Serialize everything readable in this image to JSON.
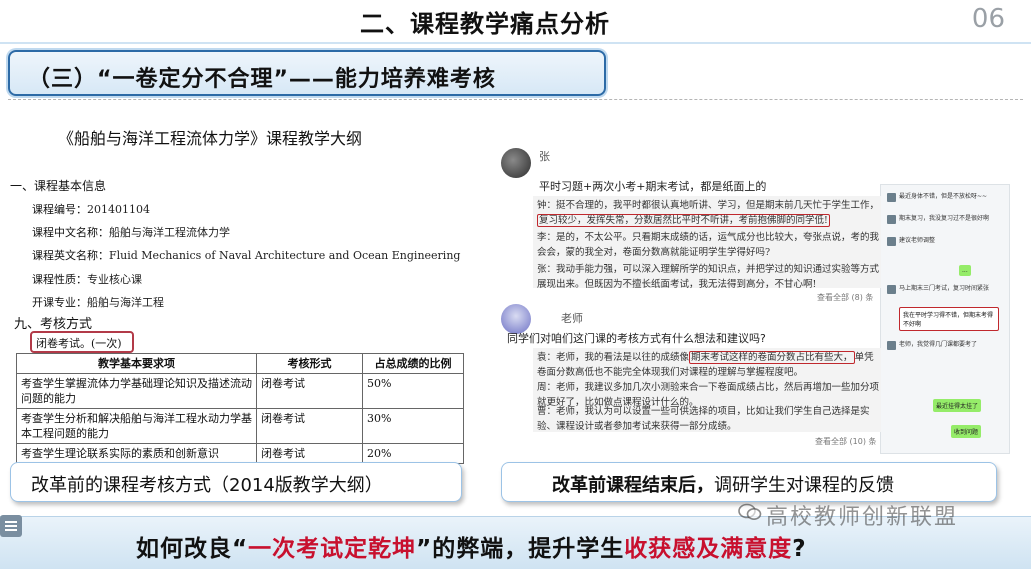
{
  "header": {
    "title": "二、课程教学痛点分析",
    "page_number": "06"
  },
  "banner": {
    "text": "（三）“一卷定分不合理”——能力培养难考核"
  },
  "syllabus": {
    "title": "《船舶与海洋工程流体力学》课程教学大纲",
    "section1": "一、课程基本信息",
    "fields": [
      {
        "label": "课程编号：",
        "value": "201401104"
      },
      {
        "label": "课程中文名称：",
        "value": "船舶与海洋工程流体力学"
      },
      {
        "label": "课程英文名称：",
        "value": "Fluid Mechanics of Naval Architecture and Ocean Engineering"
      },
      {
        "label": "课程性质：",
        "value": "专业核心课"
      },
      {
        "label": "开课专业：",
        "value": "船舶与海洋工程"
      }
    ],
    "section9": "九、考核方式",
    "closed_exam": "闭卷考试。(一次)",
    "table": {
      "headers": [
        "教学基本要求项",
        "考核形式",
        "占总成绩的比例"
      ],
      "rows": [
        [
          "考查学生掌握流体力学基础理论知识及描述流动问题的能力",
          "闭卷考试",
          "50%"
        ],
        [
          "考查学生分析和解决船舶与海洋工程水动力学基本工程问题的能力",
          "闭卷考试",
          "30%"
        ],
        [
          "考查学生理论联系实际的素质和创新意识",
          "闭卷考试",
          "20%"
        ]
      ]
    }
  },
  "caption_left": "改革前的课程考核方式（2014版教学大纲）",
  "chat": {
    "post1": {
      "sender": "张",
      "text": "平时习题+两次小考+期末考试，都是纸面上的"
    },
    "replies1": [
      {
        "who": "钟",
        "pre": "挺不合理的，我平时都很认真地听讲、学习，但是期末前几天忙于学生工作，",
        "hl": "复习较少，发挥失常，分数居然比平时不听讲，考前抱佛脚的同学低!",
        "post": ""
      },
      {
        "who": "李",
        "pre": "是的，不太公平。只看期末成绩的话，运气成分也比较大，夸张点说，考的我会会，蒙的我全对，卷面分数高就能证明学生学得好吗?",
        "hl": "",
        "post": ""
      },
      {
        "who": "张",
        "pre": "我动手能力强，可以深入理解所学的知识点，并把学过的知识通过实验等方式展现出来。但既因为不擅长纸面考试，我无法得到高分，不甘心啊!",
        "hl": "",
        "post": ""
      }
    ],
    "view_all_1": "查看全部 (8) 条",
    "post2": {
      "sender": "老师",
      "text": "同学们对咱们这门课的考核方式有什么想法和建议吗?"
    },
    "replies2": [
      {
        "who": "袁",
        "pre": "老师，我的看法是以往的成绩像",
        "hl": "期末考试这样的卷面分数占比有些大，",
        "post": "单凭卷面分数高低也不能完全体现我们对课程的理解与掌握程度吧。"
      },
      {
        "who": "周",
        "pre": "老师，我建议多加几次小测验来合一下卷面成绩占比，然后再增加一些加分项就更好了，比如做点课程设计什么的。",
        "hl": "",
        "post": ""
      },
      {
        "who": "曹",
        "pre": "老师，我认为可以设置一些可供选择的项目，比如让我们学生自己选择是实验、课程设计或者参加考试来获得一部分成绩。",
        "hl": "",
        "post": ""
      }
    ],
    "view_all_2": "查看全部 (10) 条",
    "side_messages": [
      "最近身体不错，但是不放松呀~~",
      "期末复习，我没复习过不是很好啊",
      "建议老师调整",
      "马上期末三门考试，复习时间紧张",
      "我在平时学习得不错，但期末考得不好啊",
      "老师，我觉得几门课都要考了",
      "最近挂得太挂了",
      "收到问题"
    ]
  },
  "caption_right": {
    "bold": "改革前课程结束后，",
    "rest": "调研学生对课程的反馈"
  },
  "bottom": {
    "part1": "如何改良“",
    "red1": "一次考试定乾坤",
    "part2": "”的弊端，提升学生",
    "red2": "收获感及满意度",
    "part3": "?"
  },
  "watermark": "高校教师创新联盟"
}
